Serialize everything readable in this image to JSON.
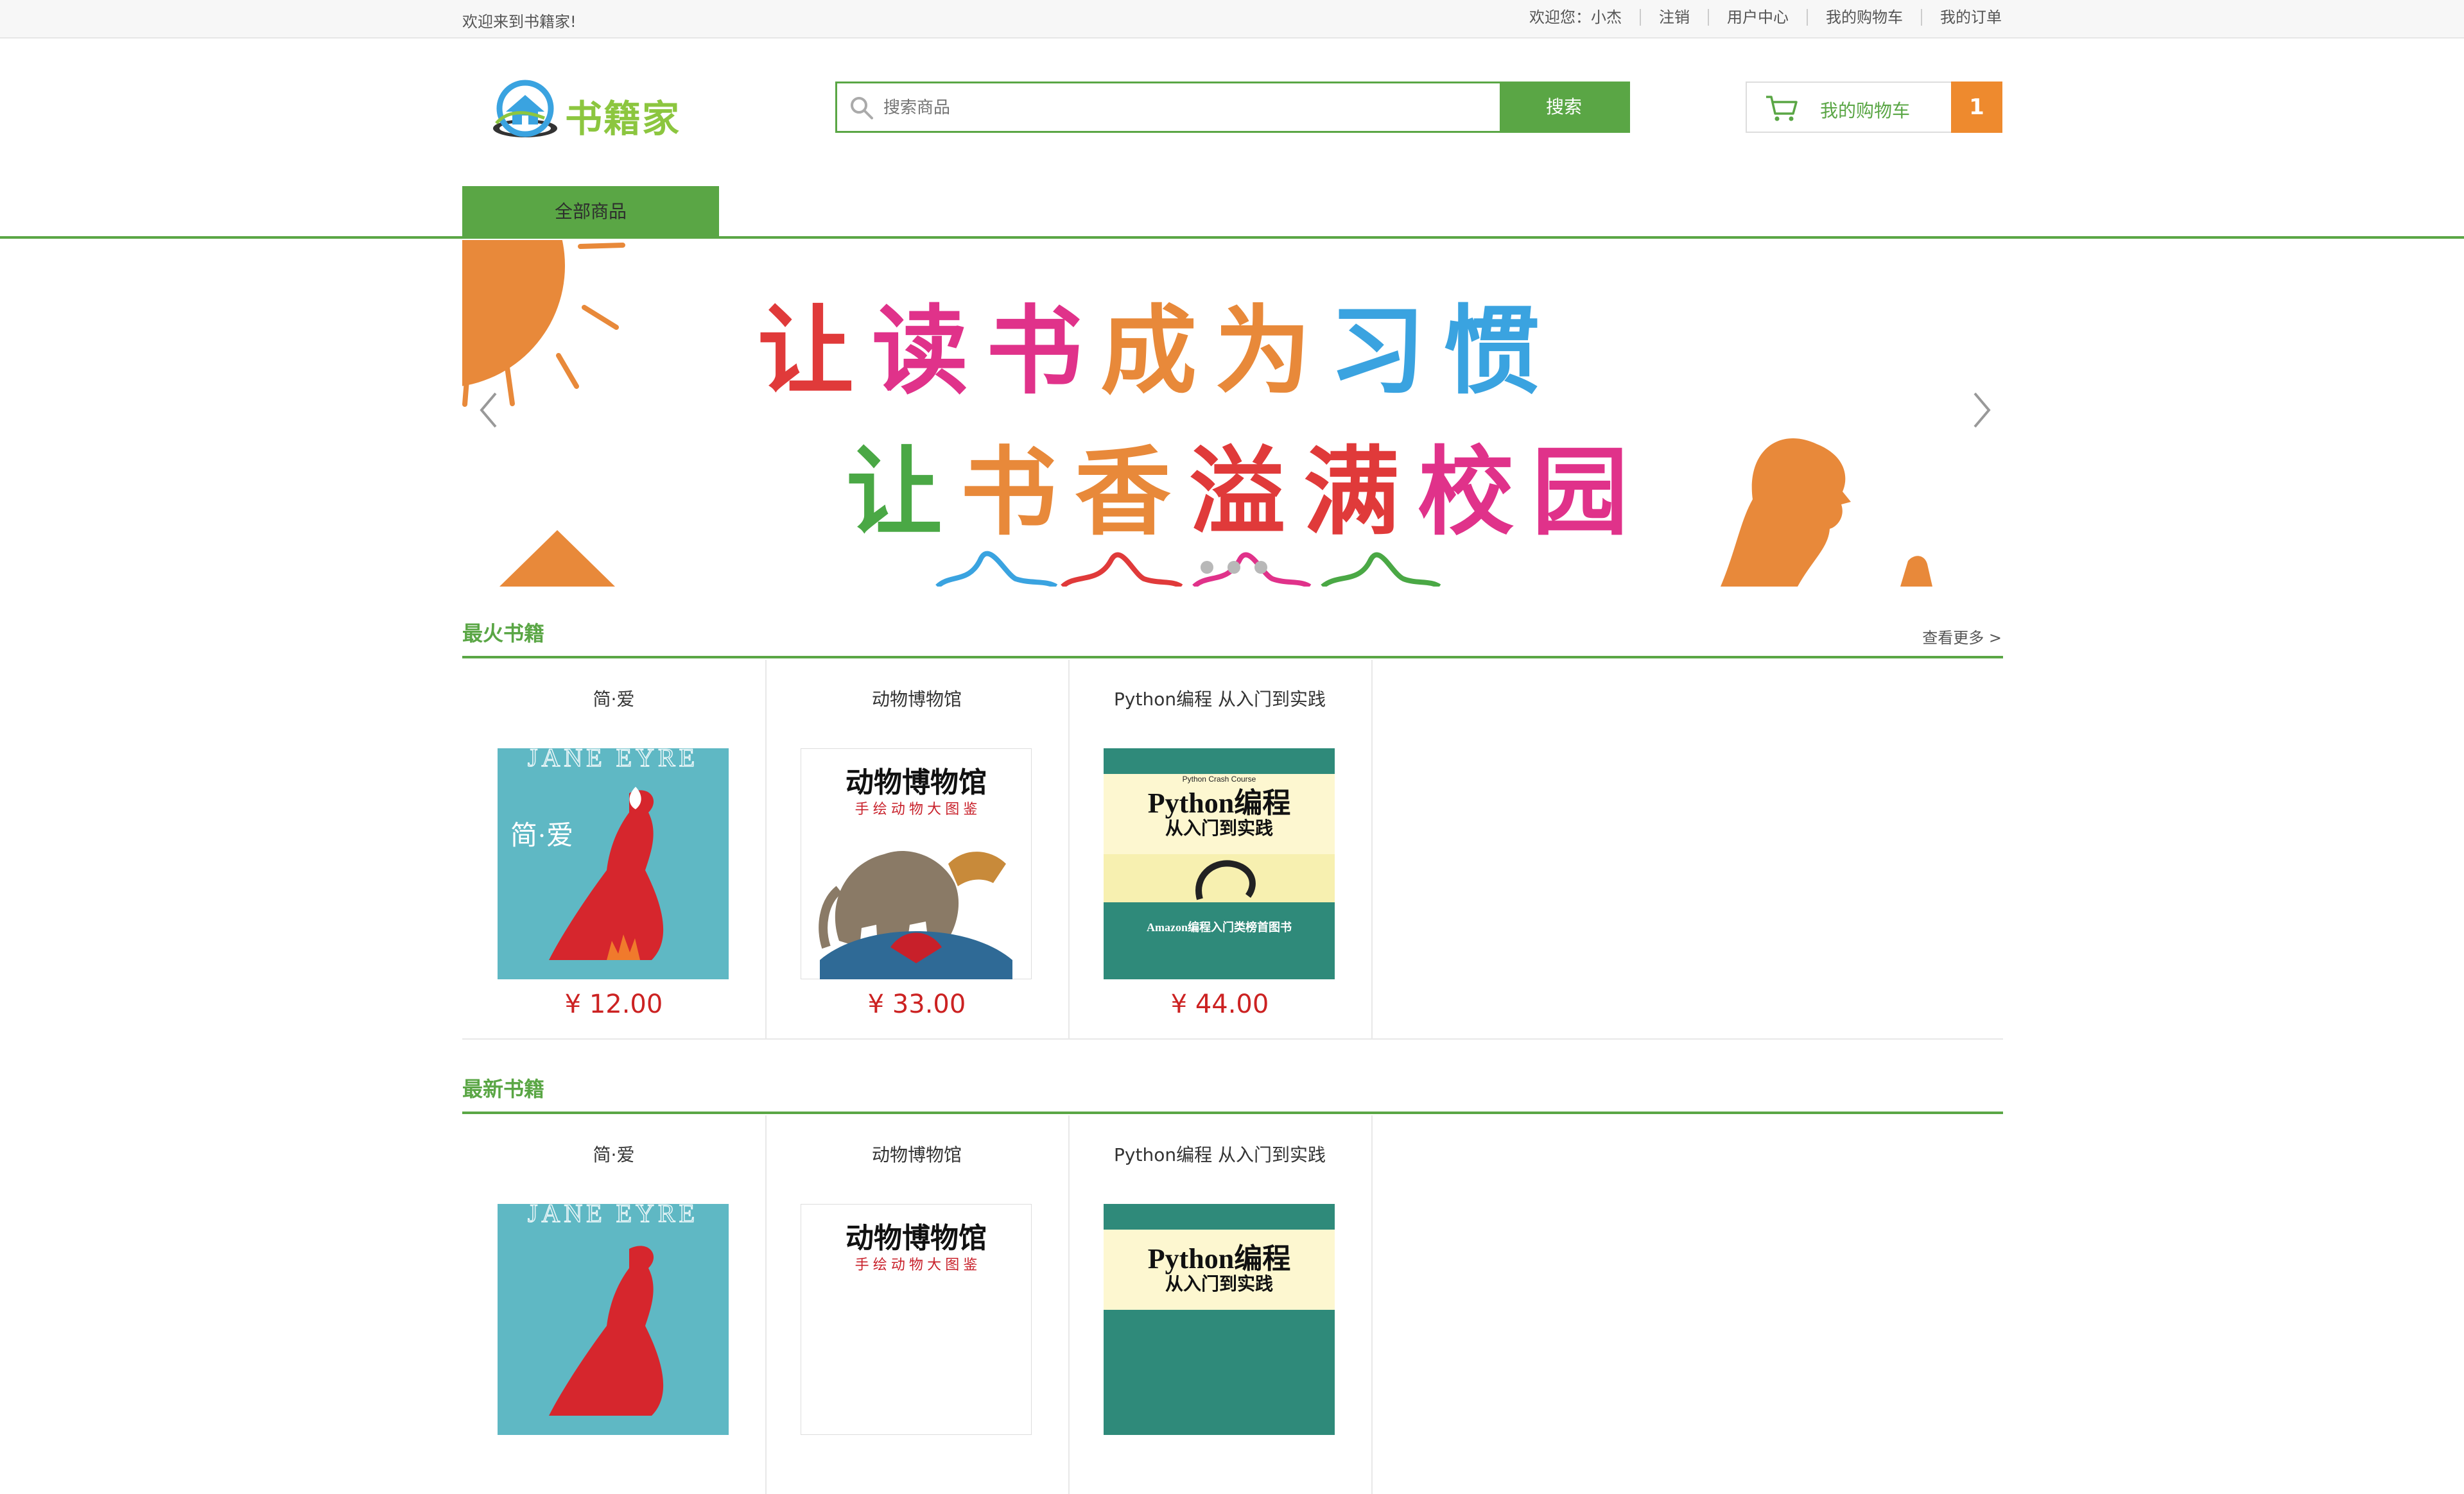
{
  "top_bar": {
    "welcome": "欢迎来到书籍家!",
    "user_greeting": "欢迎您：小杰",
    "logout": "注销",
    "user_center": "用户中心",
    "my_cart": "我的购物车",
    "my_orders": "我的订单"
  },
  "header": {
    "logo_text": "书籍家",
    "search_placeholder": "搜索商品",
    "search_button": "搜索",
    "cart_label": "我的购物车",
    "cart_count": "1"
  },
  "nav": {
    "all_products": "全部商品"
  },
  "banner": {
    "line1_chars": [
      "让",
      "读",
      "书",
      "成",
      "为",
      "习",
      "惯"
    ],
    "line2_chars": [
      "让",
      "书",
      "香",
      "溢",
      "满",
      "校",
      "园"
    ],
    "colors": {
      "red": "#e03a3a",
      "pink": "#e0328a",
      "orange": "#e8893a",
      "blue": "#3aa3e0",
      "green": "#4aa845"
    },
    "slide_count": 3
  },
  "sections": {
    "hot": {
      "title": "最火书籍",
      "more": "查看更多 >",
      "products": [
        {
          "name": "简·爱",
          "price": "¥ 12.00",
          "cover": "jane-eyre"
        },
        {
          "name": "动物博物馆",
          "price": "¥ 33.00",
          "cover": "animal-museum"
        },
        {
          "name": "Python编程 从入门到实践",
          "price": "¥ 44.00",
          "cover": "python-crash-course"
        }
      ]
    },
    "new": {
      "title": "最新书籍",
      "products": [
        {
          "name": "简·爱",
          "cover": "jane-eyre"
        },
        {
          "name": "动物博物馆",
          "cover": "animal-museum"
        },
        {
          "name": "Python编程 从入门到实践",
          "cover": "python-crash-course"
        }
      ]
    }
  },
  "covers": {
    "jane_eyre": {
      "en_title": "JANE EYRE",
      "cn_title": "简·爱"
    },
    "animal_museum": {
      "title": "动物博物馆",
      "subtitle": "手 绘 动 物 大 图 鉴"
    },
    "python": {
      "top": "Python Crash Course",
      "title": "Python编程",
      "subtitle": "从入门到实践",
      "badge": "Amazon编程入门类榜首图书"
    }
  },
  "theme": {
    "green": "#5aa645",
    "orange": "#ee8a2e",
    "price_red": "#cc2222"
  }
}
